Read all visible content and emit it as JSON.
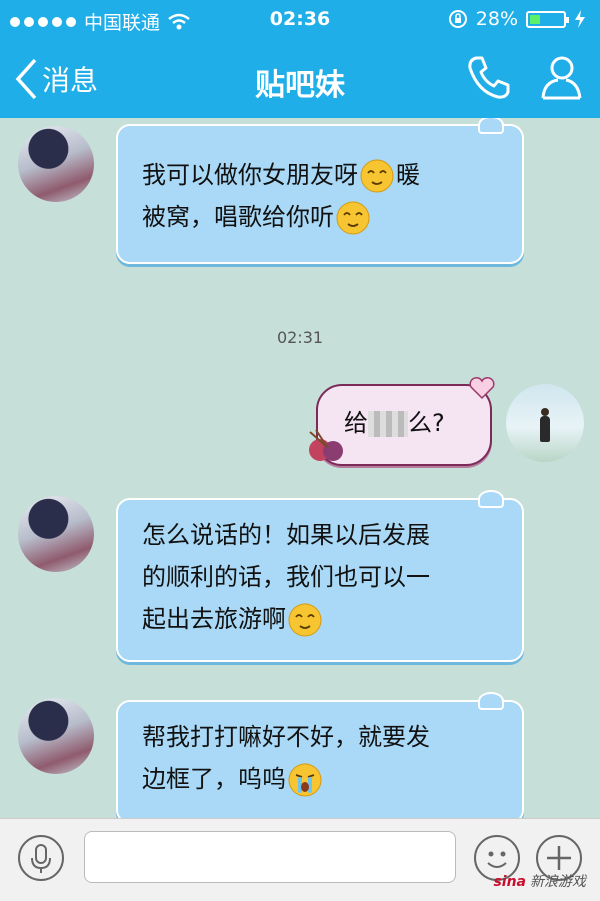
{
  "status_bar": {
    "carrier": "中国联通",
    "time": "02:36",
    "battery_percent": "28%",
    "battery_level": 0.28
  },
  "header": {
    "back_label": "消息",
    "title": "贴吧妹",
    "icons": [
      "phone-icon",
      "contact-icon"
    ]
  },
  "messages": [
    {
      "side": "left",
      "lines": [
        "我可以做你女朋友呀",
        "暖",
        "被窝，唱歌给你听"
      ],
      "emoji": "sleepy-smile-emoji"
    },
    {
      "timestamp": "02:31"
    },
    {
      "side": "right",
      "before_blur": "给",
      "after_blur": "么?"
    },
    {
      "side": "left",
      "lines": [
        "怎么说话的！如果以后发展",
        "的顺利的话，我们也可以一",
        "起出去旅游啊"
      ],
      "emoji": "sleepy-smile-emoji"
    },
    {
      "side": "left",
      "lines": [
        "帮我打打嘛好不好，就要发",
        "边框了，呜呜"
      ],
      "emoji": "crying-emoji"
    }
  ],
  "watermark": {
    "brand": "sina",
    "text": "新浪游戏"
  },
  "colors": {
    "accent": "#1faee8",
    "bubble": "#a9d9f6",
    "chat_bg": "#c6dfd8"
  }
}
